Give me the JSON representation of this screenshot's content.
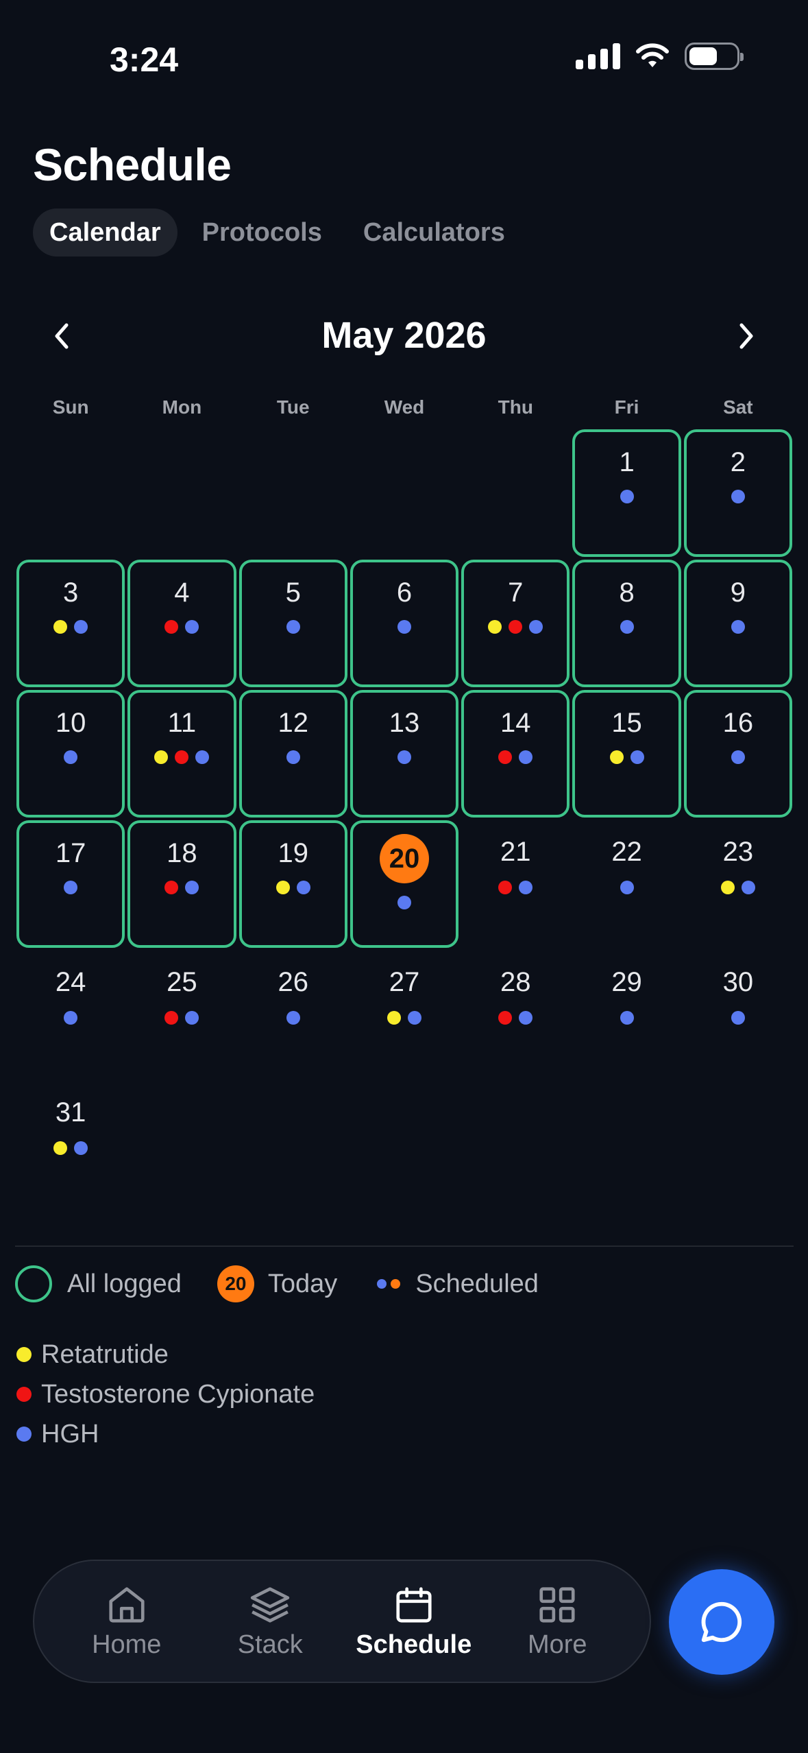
{
  "status": {
    "time": "3:24"
  },
  "header": {
    "title": "Schedule"
  },
  "tabs": [
    {
      "label": "Calendar",
      "active": true
    },
    {
      "label": "Protocols",
      "active": false
    },
    {
      "label": "Calculators",
      "active": false
    }
  ],
  "calendar": {
    "month_label": "May 2026",
    "weekdays": [
      "Sun",
      "Mon",
      "Tue",
      "Wed",
      "Thu",
      "Fri",
      "Sat"
    ],
    "first_weekday_index": 5,
    "today": 20,
    "days": [
      {
        "day": 1,
        "logged": true,
        "dots": [
          "hgh"
        ]
      },
      {
        "day": 2,
        "logged": true,
        "dots": [
          "hgh"
        ]
      },
      {
        "day": 3,
        "logged": true,
        "dots": [
          "retatrutide",
          "hgh"
        ]
      },
      {
        "day": 4,
        "logged": true,
        "dots": [
          "testosterone",
          "hgh"
        ]
      },
      {
        "day": 5,
        "logged": true,
        "dots": [
          "hgh"
        ]
      },
      {
        "day": 6,
        "logged": true,
        "dots": [
          "hgh"
        ]
      },
      {
        "day": 7,
        "logged": true,
        "dots": [
          "retatrutide",
          "testosterone",
          "hgh"
        ]
      },
      {
        "day": 8,
        "logged": true,
        "dots": [
          "hgh"
        ]
      },
      {
        "day": 9,
        "logged": true,
        "dots": [
          "hgh"
        ]
      },
      {
        "day": 10,
        "logged": true,
        "dots": [
          "hgh"
        ]
      },
      {
        "day": 11,
        "logged": true,
        "dots": [
          "retatrutide",
          "testosterone",
          "hgh"
        ]
      },
      {
        "day": 12,
        "logged": true,
        "dots": [
          "hgh"
        ]
      },
      {
        "day": 13,
        "logged": true,
        "dots": [
          "hgh"
        ]
      },
      {
        "day": 14,
        "logged": true,
        "dots": [
          "testosterone",
          "hgh"
        ]
      },
      {
        "day": 15,
        "logged": true,
        "dots": [
          "retatrutide",
          "hgh"
        ]
      },
      {
        "day": 16,
        "logged": true,
        "dots": [
          "hgh"
        ]
      },
      {
        "day": 17,
        "logged": true,
        "dots": [
          "hgh"
        ]
      },
      {
        "day": 18,
        "logged": true,
        "dots": [
          "testosterone",
          "hgh"
        ]
      },
      {
        "day": 19,
        "logged": true,
        "dots": [
          "retatrutide",
          "hgh"
        ]
      },
      {
        "day": 20,
        "logged": true,
        "dots": [
          "hgh"
        ]
      },
      {
        "day": 21,
        "logged": false,
        "dots": [
          "testosterone",
          "hgh"
        ]
      },
      {
        "day": 22,
        "logged": false,
        "dots": [
          "hgh"
        ]
      },
      {
        "day": 23,
        "logged": false,
        "dots": [
          "retatrutide",
          "hgh"
        ]
      },
      {
        "day": 24,
        "logged": false,
        "dots": [
          "hgh"
        ]
      },
      {
        "day": 25,
        "logged": false,
        "dots": [
          "testosterone",
          "hgh"
        ]
      },
      {
        "day": 26,
        "logged": false,
        "dots": [
          "hgh"
        ]
      },
      {
        "day": 27,
        "logged": false,
        "dots": [
          "retatrutide",
          "hgh"
        ]
      },
      {
        "day": 28,
        "logged": false,
        "dots": [
          "testosterone",
          "hgh"
        ]
      },
      {
        "day": 29,
        "logged": false,
        "dots": [
          "hgh"
        ]
      },
      {
        "day": 30,
        "logged": false,
        "dots": [
          "hgh"
        ]
      },
      {
        "day": 31,
        "logged": false,
        "dots": [
          "retatrutide",
          "hgh"
        ]
      }
    ]
  },
  "legend": {
    "all_logged": "All logged",
    "today_badge": "20",
    "today": "Today",
    "scheduled": "Scheduled"
  },
  "peptides": [
    {
      "key": "retatrutide",
      "name": "Retatrutide",
      "color": "#f8ec2c"
    },
    {
      "key": "testosterone",
      "name": "Testosterone Cypionate",
      "color": "#f01414"
    },
    {
      "key": "hgh",
      "name": "HGH",
      "color": "#5a7af0"
    }
  ],
  "colors": {
    "logged_border": "#3ec48a",
    "today_accent": "#ff7a12",
    "fab": "#2a6ef4",
    "scheduled_legend_dots": [
      "#5a7af0",
      "#ff7a12"
    ]
  },
  "tabbar": [
    {
      "label": "Home",
      "icon": "home-icon",
      "active": false
    },
    {
      "label": "Stack",
      "icon": "layers-icon",
      "active": false
    },
    {
      "label": "Schedule",
      "icon": "calendar-icon",
      "active": true
    },
    {
      "label": "More",
      "icon": "grid-icon",
      "active": false
    }
  ],
  "fab": {
    "icon": "chat-bubble-icon"
  }
}
